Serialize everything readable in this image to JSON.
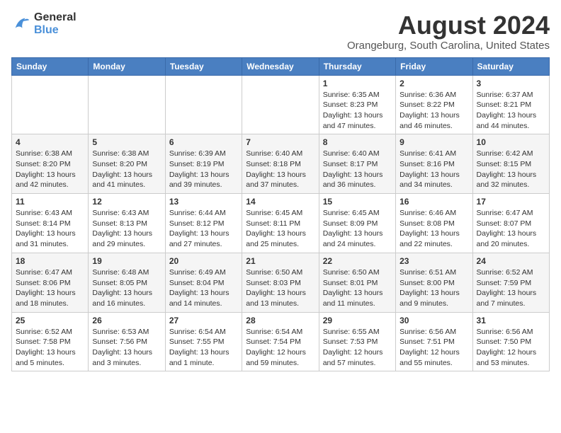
{
  "logo": {
    "line1": "General",
    "line2": "Blue"
  },
  "title": "August 2024",
  "subtitle": "Orangeburg, South Carolina, United States",
  "weekdays": [
    "Sunday",
    "Monday",
    "Tuesday",
    "Wednesday",
    "Thursday",
    "Friday",
    "Saturday"
  ],
  "weeks": [
    [
      {
        "day": "",
        "info": ""
      },
      {
        "day": "",
        "info": ""
      },
      {
        "day": "",
        "info": ""
      },
      {
        "day": "",
        "info": ""
      },
      {
        "day": "1",
        "info": "Sunrise: 6:35 AM\nSunset: 8:23 PM\nDaylight: 13 hours\nand 47 minutes."
      },
      {
        "day": "2",
        "info": "Sunrise: 6:36 AM\nSunset: 8:22 PM\nDaylight: 13 hours\nand 46 minutes."
      },
      {
        "day": "3",
        "info": "Sunrise: 6:37 AM\nSunset: 8:21 PM\nDaylight: 13 hours\nand 44 minutes."
      }
    ],
    [
      {
        "day": "4",
        "info": "Sunrise: 6:38 AM\nSunset: 8:20 PM\nDaylight: 13 hours\nand 42 minutes."
      },
      {
        "day": "5",
        "info": "Sunrise: 6:38 AM\nSunset: 8:20 PM\nDaylight: 13 hours\nand 41 minutes."
      },
      {
        "day": "6",
        "info": "Sunrise: 6:39 AM\nSunset: 8:19 PM\nDaylight: 13 hours\nand 39 minutes."
      },
      {
        "day": "7",
        "info": "Sunrise: 6:40 AM\nSunset: 8:18 PM\nDaylight: 13 hours\nand 37 minutes."
      },
      {
        "day": "8",
        "info": "Sunrise: 6:40 AM\nSunset: 8:17 PM\nDaylight: 13 hours\nand 36 minutes."
      },
      {
        "day": "9",
        "info": "Sunrise: 6:41 AM\nSunset: 8:16 PM\nDaylight: 13 hours\nand 34 minutes."
      },
      {
        "day": "10",
        "info": "Sunrise: 6:42 AM\nSunset: 8:15 PM\nDaylight: 13 hours\nand 32 minutes."
      }
    ],
    [
      {
        "day": "11",
        "info": "Sunrise: 6:43 AM\nSunset: 8:14 PM\nDaylight: 13 hours\nand 31 minutes."
      },
      {
        "day": "12",
        "info": "Sunrise: 6:43 AM\nSunset: 8:13 PM\nDaylight: 13 hours\nand 29 minutes."
      },
      {
        "day": "13",
        "info": "Sunrise: 6:44 AM\nSunset: 8:12 PM\nDaylight: 13 hours\nand 27 minutes."
      },
      {
        "day": "14",
        "info": "Sunrise: 6:45 AM\nSunset: 8:11 PM\nDaylight: 13 hours\nand 25 minutes."
      },
      {
        "day": "15",
        "info": "Sunrise: 6:45 AM\nSunset: 8:09 PM\nDaylight: 13 hours\nand 24 minutes."
      },
      {
        "day": "16",
        "info": "Sunrise: 6:46 AM\nSunset: 8:08 PM\nDaylight: 13 hours\nand 22 minutes."
      },
      {
        "day": "17",
        "info": "Sunrise: 6:47 AM\nSunset: 8:07 PM\nDaylight: 13 hours\nand 20 minutes."
      }
    ],
    [
      {
        "day": "18",
        "info": "Sunrise: 6:47 AM\nSunset: 8:06 PM\nDaylight: 13 hours\nand 18 minutes."
      },
      {
        "day": "19",
        "info": "Sunrise: 6:48 AM\nSunset: 8:05 PM\nDaylight: 13 hours\nand 16 minutes."
      },
      {
        "day": "20",
        "info": "Sunrise: 6:49 AM\nSunset: 8:04 PM\nDaylight: 13 hours\nand 14 minutes."
      },
      {
        "day": "21",
        "info": "Sunrise: 6:50 AM\nSunset: 8:03 PM\nDaylight: 13 hours\nand 13 minutes."
      },
      {
        "day": "22",
        "info": "Sunrise: 6:50 AM\nSunset: 8:01 PM\nDaylight: 13 hours\nand 11 minutes."
      },
      {
        "day": "23",
        "info": "Sunrise: 6:51 AM\nSunset: 8:00 PM\nDaylight: 13 hours\nand 9 minutes."
      },
      {
        "day": "24",
        "info": "Sunrise: 6:52 AM\nSunset: 7:59 PM\nDaylight: 13 hours\nand 7 minutes."
      }
    ],
    [
      {
        "day": "25",
        "info": "Sunrise: 6:52 AM\nSunset: 7:58 PM\nDaylight: 13 hours\nand 5 minutes."
      },
      {
        "day": "26",
        "info": "Sunrise: 6:53 AM\nSunset: 7:56 PM\nDaylight: 13 hours\nand 3 minutes."
      },
      {
        "day": "27",
        "info": "Sunrise: 6:54 AM\nSunset: 7:55 PM\nDaylight: 13 hours\nand 1 minute."
      },
      {
        "day": "28",
        "info": "Sunrise: 6:54 AM\nSunset: 7:54 PM\nDaylight: 12 hours\nand 59 minutes."
      },
      {
        "day": "29",
        "info": "Sunrise: 6:55 AM\nSunset: 7:53 PM\nDaylight: 12 hours\nand 57 minutes."
      },
      {
        "day": "30",
        "info": "Sunrise: 6:56 AM\nSunset: 7:51 PM\nDaylight: 12 hours\nand 55 minutes."
      },
      {
        "day": "31",
        "info": "Sunrise: 6:56 AM\nSunset: 7:50 PM\nDaylight: 12 hours\nand 53 minutes."
      }
    ]
  ]
}
